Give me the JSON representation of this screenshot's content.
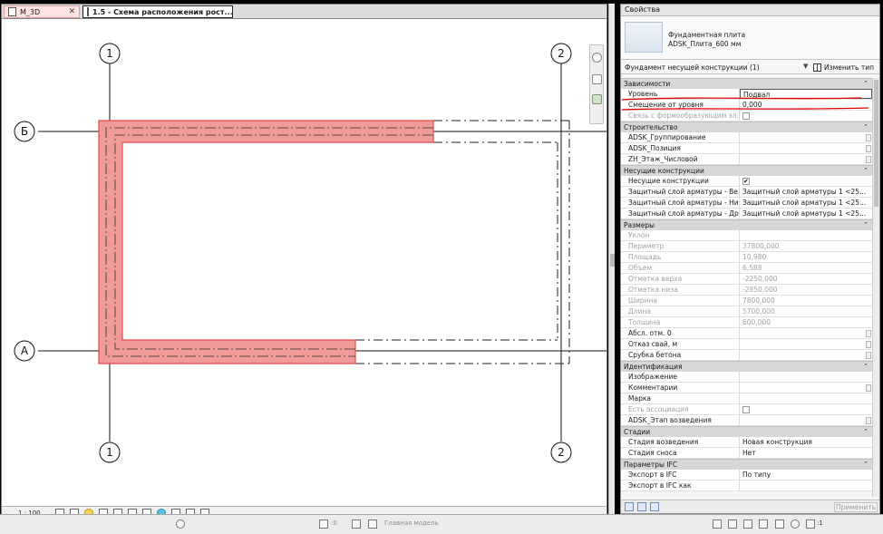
{
  "view": {
    "tabs": [
      {
        "label": "М_3D",
        "close": "✕"
      },
      {
        "label": "1.5 - Схема расположения рост...",
        "close": "✕"
      }
    ],
    "grid_labels": {
      "top_left": "1",
      "top_right": "2",
      "bottom_left": "1",
      "bottom_right": "2",
      "row_b": "Б",
      "row_a": "А"
    },
    "scale": "1 : 100"
  },
  "statusbar": {
    "zero": ":0",
    "model": "Главная модель",
    "filter_count": ":1"
  },
  "properties": {
    "title": "Свойства",
    "type_name_line1": "Фундаментная плита",
    "type_name_line2": "ADSK_Плита_600 мм",
    "instance_filter": "Фундамент несущей конструкции (1)",
    "edit_type": "Изменить тип",
    "apply": "Применить",
    "groups": [
      {
        "name": "Зависимости",
        "rows": [
          {
            "k": "Уровень",
            "v": "Подвал"
          },
          {
            "k": "Смещение от уровня",
            "v": "0,000"
          },
          {
            "k": "Связь с формообразующим эл...",
            "v": ""
          }
        ]
      },
      {
        "name": "Строительство",
        "rows": [
          {
            "k": "ADSK_Группирование",
            "v": ""
          },
          {
            "k": "ADSK_Позиция",
            "v": ""
          },
          {
            "k": "ZH_Этаж_Числовой",
            "v": ""
          }
        ]
      },
      {
        "name": "Несущие конструкции",
        "rows": [
          {
            "k": "Несущие конструкции",
            "v": ""
          },
          {
            "k": "Защитный слой арматуры - Ве...",
            "v": "Защитный слой арматуры 1 <25..."
          },
          {
            "k": "Защитный слой арматуры - Ни...",
            "v": "Защитный слой арматуры 1 <25..."
          },
          {
            "k": "Защитный слой арматуры - Др...",
            "v": "Защитный слой арматуры 1 <25..."
          }
        ]
      },
      {
        "name": "Размеры",
        "rows": [
          {
            "k": "Уклон",
            "v": ""
          },
          {
            "k": "Периметр",
            "v": "37800,000"
          },
          {
            "k": "Площадь",
            "v": "10,980"
          },
          {
            "k": "Объем",
            "v": "6,588"
          },
          {
            "k": "Отметка верха",
            "v": "-2250,000"
          },
          {
            "k": "Отметка низа",
            "v": "-2850,000"
          },
          {
            "k": "Ширина",
            "v": "7800,000"
          },
          {
            "k": "Длина",
            "v": "5700,000"
          },
          {
            "k": "Толщина",
            "v": "600,000"
          },
          {
            "k": "Абсл. отм. 0",
            "v": ""
          },
          {
            "k": "Отказ свай, м",
            "v": ""
          },
          {
            "k": "Срубка бетона",
            "v": ""
          }
        ]
      },
      {
        "name": "Идентификация",
        "rows": [
          {
            "k": "Изображение",
            "v": ""
          },
          {
            "k": "Комментарии",
            "v": ""
          },
          {
            "k": "Марка",
            "v": ""
          },
          {
            "k": "Есть ассоциация",
            "v": ""
          },
          {
            "k": "ADSK_Этап возведения",
            "v": ""
          }
        ]
      },
      {
        "name": "Стадии",
        "rows": [
          {
            "k": "Стадия возведения",
            "v": "Новая конструкция"
          },
          {
            "k": "Стадия сноса",
            "v": "Нет"
          }
        ]
      },
      {
        "name": "Параметры IFC",
        "rows": [
          {
            "k": "Экспорт в IFC",
            "v": "По типу"
          },
          {
            "k": "Экспорт в IFC как",
            "v": ""
          }
        ]
      }
    ]
  }
}
